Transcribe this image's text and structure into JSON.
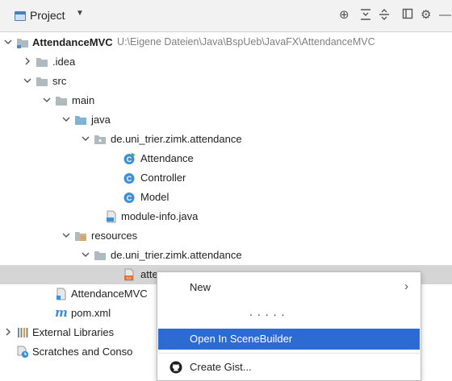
{
  "toolbar": {
    "title": "Project",
    "icons": [
      "project-icon",
      "locate-icon",
      "collapse-all-icon",
      "expand-all-icon",
      "layout-icon",
      "gear-icon",
      "hide-icon"
    ]
  },
  "tree": {
    "root_label": "AttendanceMVC",
    "root_path": "U:\\Eigene Dateien\\Java\\BspUeb\\JavaFX\\AttendanceMVC",
    "idea": ".idea",
    "src": "src",
    "main": "main",
    "java": "java",
    "java_package": "de.uni_trier.zimk.attendance",
    "class_attendance": "Attendance",
    "class_controller": "Controller",
    "class_model": "Model",
    "module_info": "module-info.java",
    "resources": "resources",
    "res_package": "de.uni_trier.zimk.attendance",
    "fxml_file": "atte",
    "iml_file": "AttendanceMVC",
    "pom_m": "m",
    "pom": "pom.xml",
    "ext_libs": "External Libraries",
    "scratches": "Scratches and Conso"
  },
  "context_menu": {
    "new": "New",
    "dots": ".....",
    "open_scenebuilder": "Open In SceneBuilder",
    "create_gist": "Create Gist..."
  },
  "colors": {
    "selection": "#d5d5d5",
    "menu_highlight": "#2c6bd1",
    "folder": "#aeb9c0",
    "source_folder": "#7fb3d5",
    "class_icon": "#3d8fd9"
  }
}
